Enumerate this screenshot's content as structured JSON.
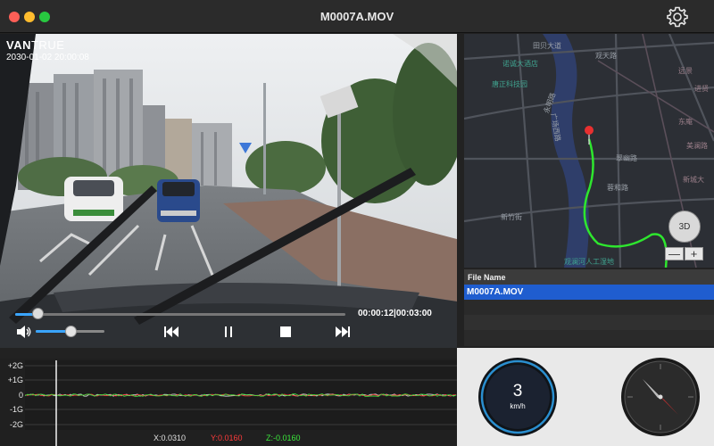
{
  "window": {
    "title": "M0007A.MOV"
  },
  "video": {
    "osd_brand_bold": "VAN",
    "osd_brand_thin": "TRUE",
    "osd_datetime": "2030-01-02 20:00:08",
    "current_time": "00:00:12",
    "total_time": "00:03:00",
    "time_separator": "|",
    "progress": 0.067,
    "volume": 0.5
  },
  "map": {
    "labels": {
      "road_1": "田贝大道",
      "road_2": "观天路",
      "poi_hotel": "诺诚大酒店",
      "poi_tech": "唐正科技园",
      "area_1": "远景",
      "area_2": "进贤",
      "area_3": "东庵",
      "area_4": "美澜路",
      "road_3": "广场西路",
      "road_4": "永明路",
      "road_5": "翠幽路",
      "road_6": "蓉和路",
      "road_7": "新竹街",
      "poi_park": "观澜河人工湿地",
      "road_8": "新城大"
    },
    "btn_3d": "3D",
    "zoom_out": "—",
    "zoom_in": "+",
    "track_color": "#2ee62e",
    "pin_color": "#e83030"
  },
  "file_list": {
    "header": "File Name",
    "files": [
      "M0007A.MOV"
    ]
  },
  "gsensor": {
    "labels": [
      "+2G",
      "+1G",
      "0",
      "-1G",
      "-2G"
    ],
    "x_readout": "X:0.0310",
    "y_readout": "Y:0.0160",
    "z_readout": "Z:-0.0160",
    "x_color": "#e0e0e0",
    "y_color": "#ff3b3b",
    "z_color": "#3be83b"
  },
  "speedometer": {
    "value": "3",
    "unit": "km/h"
  },
  "colors": {
    "accent": "#3aa5ff",
    "selection": "#1f5dcf"
  }
}
